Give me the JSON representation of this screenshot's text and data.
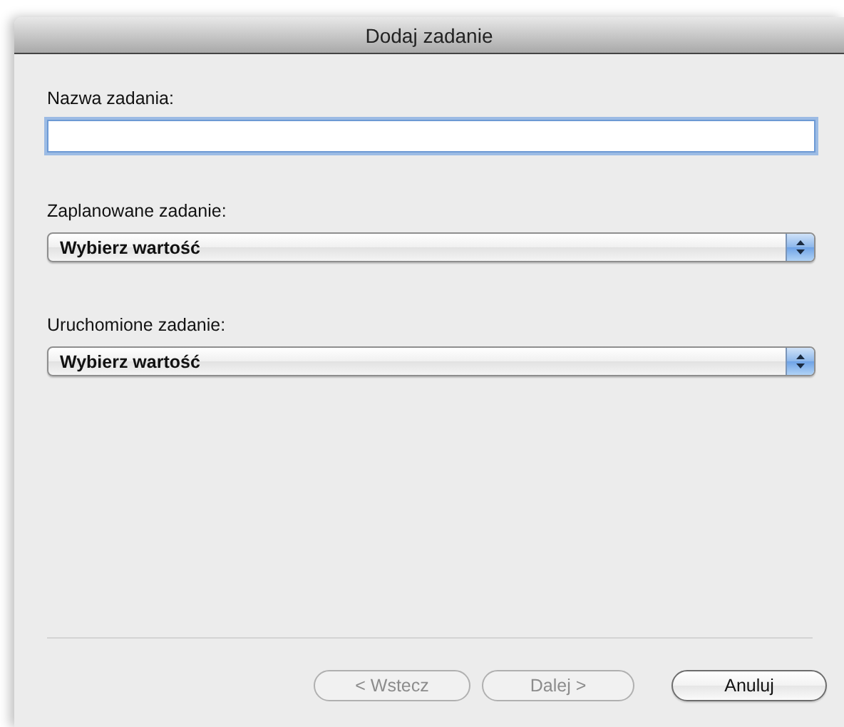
{
  "window": {
    "title": "Dodaj zadanie"
  },
  "fields": [
    {
      "kind": "text",
      "label": "Nazwa zadania:",
      "focused": true
    },
    {
      "kind": "select",
      "label": "Zaplanowane zadanie:",
      "value": "Wybierz wartość"
    },
    {
      "kind": "select",
      "label": "Uruchomione zadanie:",
      "value": "Wybierz wartość"
    }
  ],
  "buttons": [
    {
      "label": "< Wstecz",
      "disabled": true
    },
    {
      "label": "Dalej >",
      "disabled": true
    },
    {
      "label": "Anuluj",
      "disabled": false
    }
  ]
}
